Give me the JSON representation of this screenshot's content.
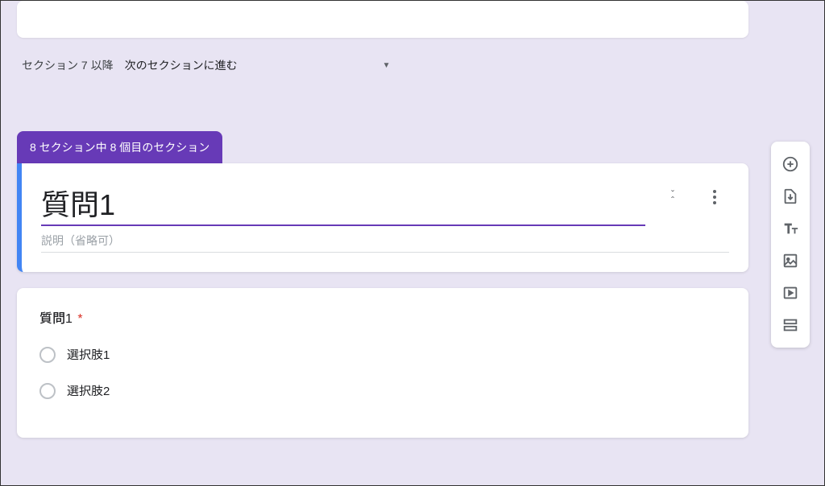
{
  "section_nav": {
    "label": "セクション 7 以降",
    "dropdown_value": "次のセクションに進む"
  },
  "section_badge": "8 セクション中 8 個目のセクション",
  "section_header": {
    "title": "質問1",
    "description_placeholder": "説明（省略可）"
  },
  "question": {
    "title": "質問1",
    "required": true,
    "options": [
      "選択肢1",
      "選択肢2"
    ]
  },
  "sidebar_icons": {
    "add": "add-circle-icon",
    "import": "import-icon",
    "title": "text-title-icon",
    "image": "image-icon",
    "video": "video-icon",
    "section": "add-section-icon"
  }
}
